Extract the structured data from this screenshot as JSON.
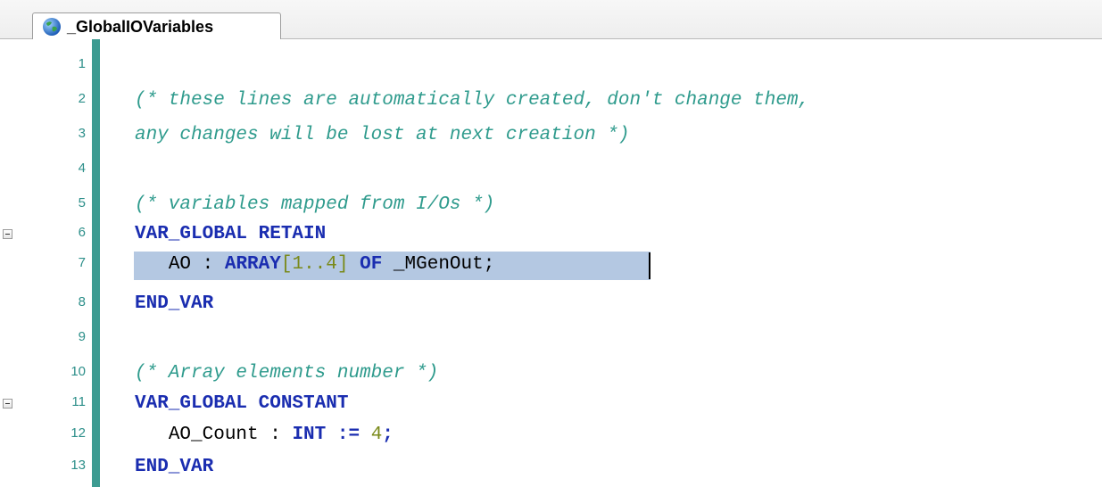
{
  "tab": {
    "label": "_GlobalIOVariables",
    "icon": "globe-icon"
  },
  "colors": {
    "comment": "#2f9b8d",
    "keyword": "#1a2db0",
    "number": "#7a8a1a",
    "gutter": "#3d9b91",
    "selection": "#b4c8e2"
  },
  "lines": [
    {
      "num": "1"
    },
    {
      "num": "2",
      "comment": "(* these lines are automatically created, don't change them,"
    },
    {
      "num": "3",
      "comment": "any changes will be lost at next creation *)"
    },
    {
      "num": "4"
    },
    {
      "num": "5",
      "comment": "(* variables mapped from I/Os *)"
    },
    {
      "num": "6",
      "kw": "VAR_GLOBAL RETAIN"
    },
    {
      "num": "7",
      "indent": "   ",
      "id1": "AO",
      "sep1": " : ",
      "kw1": "ARRAY",
      "p1": "[",
      "n1": "1..4",
      "p2": "]",
      "kw2": " OF ",
      "id2": "_MGenOut;"
    },
    {
      "num": "8",
      "kw": "END_VAR"
    },
    {
      "num": "9"
    },
    {
      "num": "10",
      "comment": "(* Array elements number *)"
    },
    {
      "num": "11",
      "kw": "VAR_GLOBAL CONSTANT"
    },
    {
      "num": "12",
      "indent": "   ",
      "id1": "AO_Count",
      "sep1": " : ",
      "kw1": "INT",
      "op": " := ",
      "n1": "4",
      "end": ";"
    },
    {
      "num": "13",
      "kw": "END_VAR"
    }
  ]
}
